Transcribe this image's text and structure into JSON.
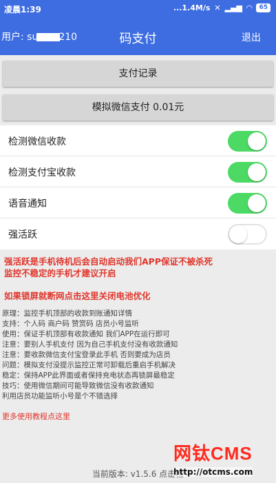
{
  "status_bar": {
    "time": "凌晨1:39",
    "net": "...1.4M/s",
    "battery": "65"
  },
  "header": {
    "user_prefix": "用户: su",
    "user_suffix": "210",
    "title": "码支付",
    "logout": "退出"
  },
  "buttons": {
    "records": "支付记录",
    "simulate": "模拟微信支付 0.01元"
  },
  "toggles": [
    {
      "label": "检测微信收款",
      "on": true
    },
    {
      "label": "检测支付宝收款",
      "on": true
    },
    {
      "label": "语音通知",
      "on": true
    },
    {
      "label": "强活跃",
      "on": false
    }
  ],
  "warnings": {
    "w1_line1": "强活跃是手机待机后会自动启动我们APP保证不被杀死",
    "w1_line2": "监控不稳定的手机才建议开启",
    "w2": "如果锁屏就断网点击这里关闭电池优化"
  },
  "notes": [
    "原理：监控手机顶部的收款到账通知详情",
    "支持：个人码 商户码 赞赏码 店员小号监听",
    "使用：保证手机顶部有收款通知 我们APP在运行即可",
    "注意：要别人手机支付 因为自己手机支付没有收款通知",
    "注意：要收款微信支付宝登录此手机 否则要成为店员",
    "问题：模拟支付没提示监控正常可卸载后重启手机解决",
    "稳定：保持APP此界面或者保持充电状态再锁屏最稳定",
    "技巧：使用微信期间可能导致微信没有收款通知",
    "利用店员功能监听小号是个不错选择"
  ],
  "more_link": "更多使用教程点这里",
  "footer": "当前版本: v1.5.6 点击检",
  "watermark": {
    "brand": "网钛CMS",
    "url": "http://otcms.com"
  }
}
